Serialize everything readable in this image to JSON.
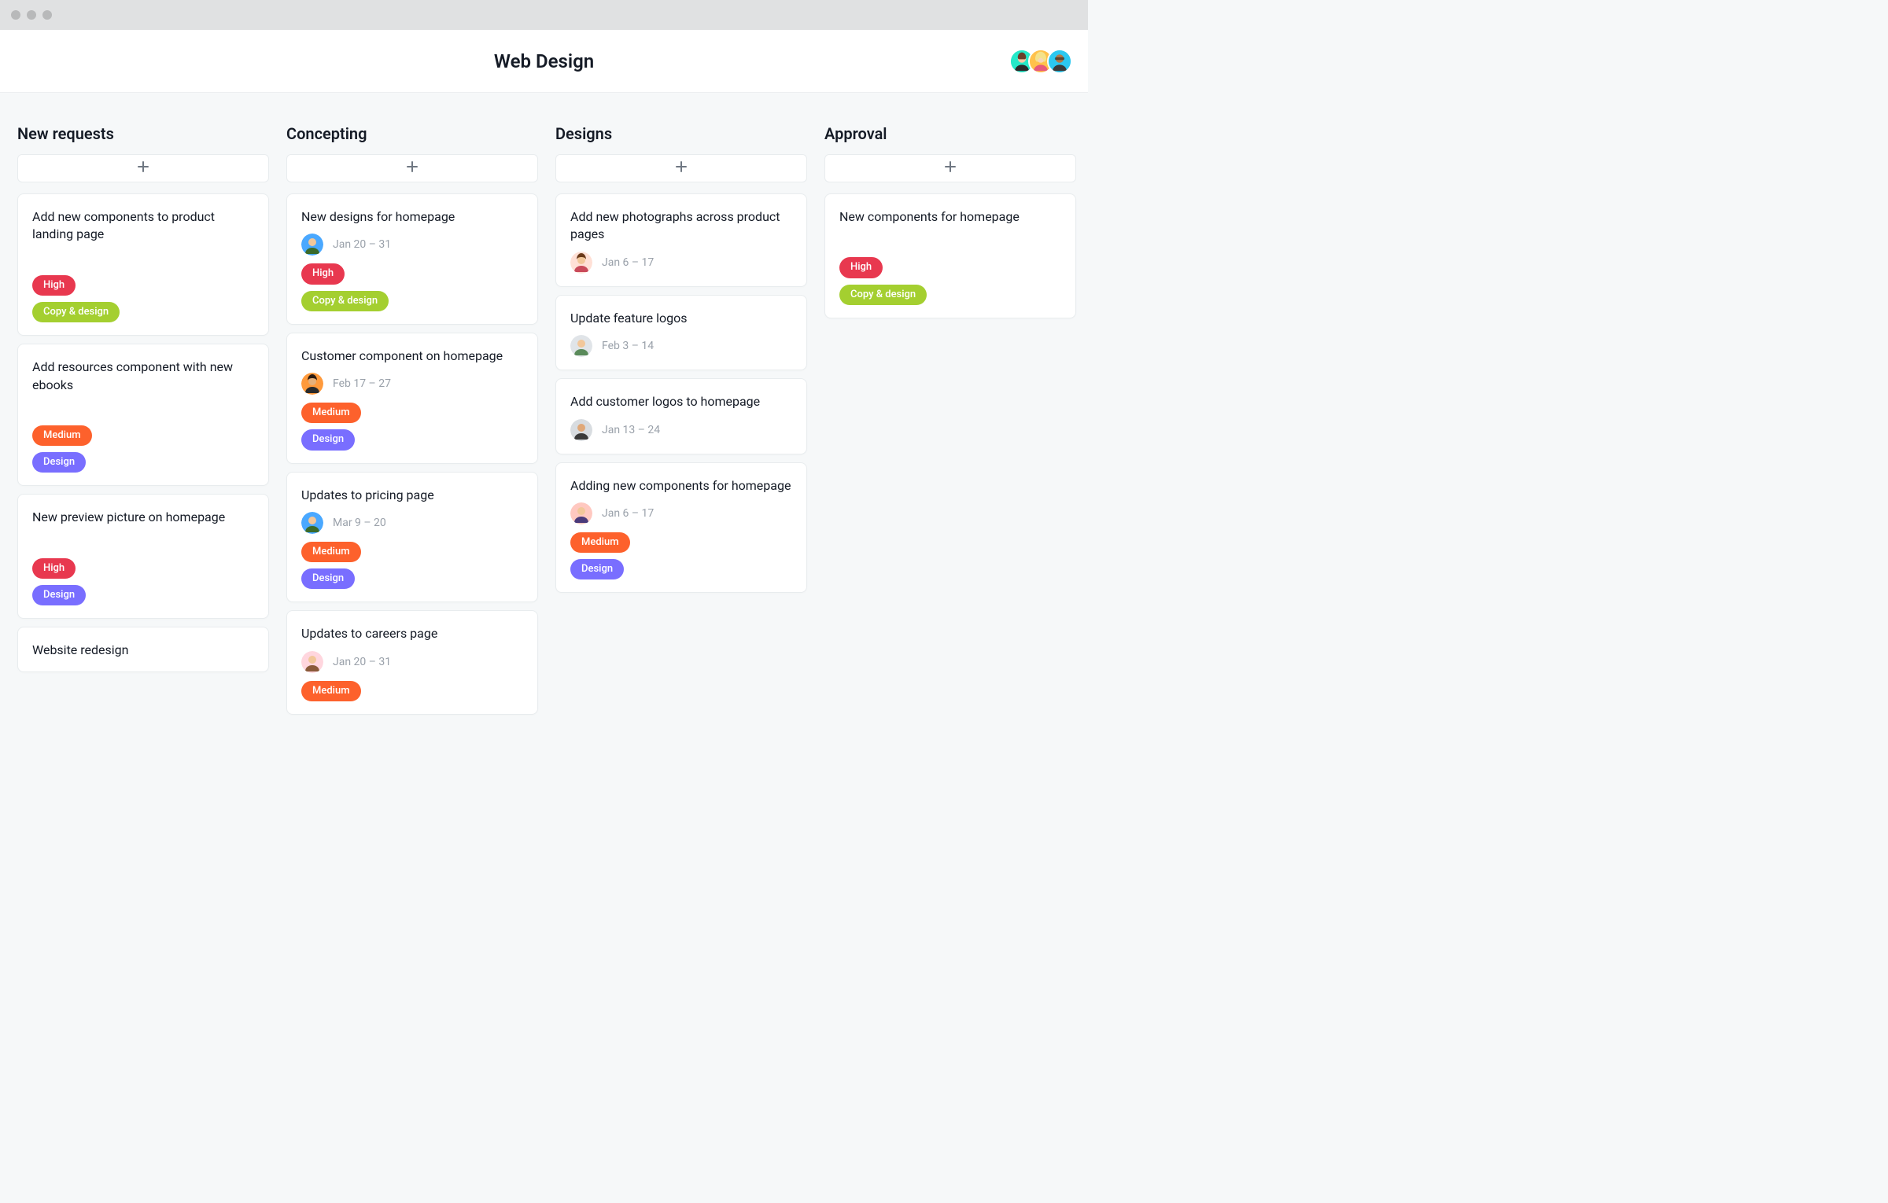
{
  "header": {
    "title": "Web Design"
  },
  "tags": {
    "high": "High",
    "medium": "Medium",
    "copy": "Copy & design",
    "design": "Design"
  },
  "columns": [
    {
      "name": "New requests",
      "cards": [
        {
          "title": "Add new components to product landing page",
          "date": null,
          "tags": [
            "high",
            "copy"
          ],
          "spacer": true
        },
        {
          "title": "Add resources component with new ebooks",
          "date": null,
          "tags": [
            "medium",
            "design"
          ],
          "spacer": true
        },
        {
          "title": "New preview picture on homepage",
          "date": null,
          "tags": [
            "high",
            "design"
          ],
          "spacer": true
        },
        {
          "title": "Website redesign",
          "date": null,
          "tags": []
        }
      ]
    },
    {
      "name": "Concepting",
      "cards": [
        {
          "title": "New designs for homepage",
          "date": "Jan 20 – 31",
          "avatar": "blue",
          "tags": [
            "high",
            "copy"
          ]
        },
        {
          "title": "Customer component on homepage",
          "date": "Feb 17 – 27",
          "avatar": "orange",
          "tags": [
            "medium",
            "design"
          ]
        },
        {
          "title": "Updates to pricing page",
          "date": "Mar 9 – 20",
          "avatar": "blue",
          "tags": [
            "medium",
            "design"
          ]
        },
        {
          "title": "Updates to careers page",
          "date": "Jan 20 – 31",
          "avatar": "pink",
          "tags": [
            "medium"
          ]
        }
      ]
    },
    {
      "name": "Designs",
      "cards": [
        {
          "title": "Add new photographs across product pages",
          "date": "Jan 6 – 17",
          "avatar": "pink2",
          "tags": []
        },
        {
          "title": "Update feature logos",
          "date": "Feb 3 – 14",
          "avatar": "gray",
          "tags": []
        },
        {
          "title": "Add customer logos to homepage",
          "date": "Jan 13 – 24",
          "avatar": "gray2",
          "tags": []
        },
        {
          "title": "Adding new components for homepage",
          "date": "Jan 6 – 17",
          "avatar": "pink3",
          "tags": [
            "medium",
            "design"
          ]
        }
      ]
    },
    {
      "name": "Approval",
      "cards": [
        {
          "title": "New components for homepage",
          "date": null,
          "tags": [
            "high",
            "copy"
          ],
          "spacer": true
        }
      ]
    }
  ]
}
